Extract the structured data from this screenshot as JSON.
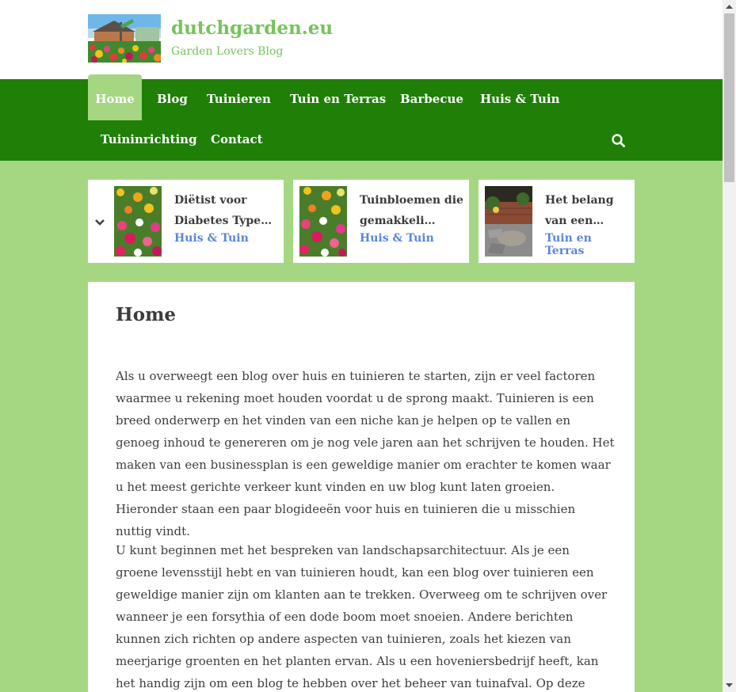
{
  "site": {
    "title": "dutchgarden.eu",
    "tagline": "Garden Lovers Blog"
  },
  "nav": {
    "items": [
      "Home",
      "Blog",
      "Tuinieren",
      "Tuin en Terras",
      "Barbecue",
      "Huis & Tuin",
      "Tuininrichting",
      "Contact"
    ]
  },
  "cards": [
    {
      "title": "Diëtist voor Diabetes Type…",
      "category": "Huis & Tuin"
    },
    {
      "title": "Tuinbloemen die gemakkeli…",
      "category": "Huis & Tuin"
    },
    {
      "title": "Het belang van een…",
      "category": "Tuin en Terras"
    }
  ],
  "page": {
    "title": "Home",
    "paragraphs": [
      "Als u overweegt een blog over huis en tuinieren te starten, zijn er veel factoren waarmee u rekening moet houden voordat u de sprong maakt. Tuinieren is een breed onderwerp en het vinden van een niche kan je helpen op te vallen en genoeg inhoud te genereren om je nog vele jaren aan het schrijven te houden. Het maken van een businessplan is een geweldige manier om erachter te komen waar u het meest gerichte verkeer kunt vinden en uw blog kunt laten groeien. Hieronder staan een paar blogideeën voor huis en tuinieren die u misschien nuttig vindt.",
      "U kunt beginnen met het bespreken van landschapsarchitectuur. Als je een groene levensstijl hebt en van tuinieren houdt, kan een blog over tuinieren een geweldige manier zijn om klanten aan te trekken. Overweeg om te schrijven over wanneer je een forsythia of een dode boom moet snoeien. Andere berichten kunnen zich richten op andere aspecten van tuinieren, zoals het kiezen van meerjarige groenten en het planten ervan. Als u een hoveniersbedrijf heeft, kan het handig zijn om een blog te hebben over het beheer van tuinafval. Op deze manier kunnen"
    ]
  },
  "icons": {
    "search": "search-icon",
    "chevron": "chevron-down-icon"
  },
  "colors": {
    "nav_bg": "#1f7f07",
    "page_bg": "#a5d783",
    "brand": "#77c35d",
    "category_link": "#5a86d8"
  }
}
